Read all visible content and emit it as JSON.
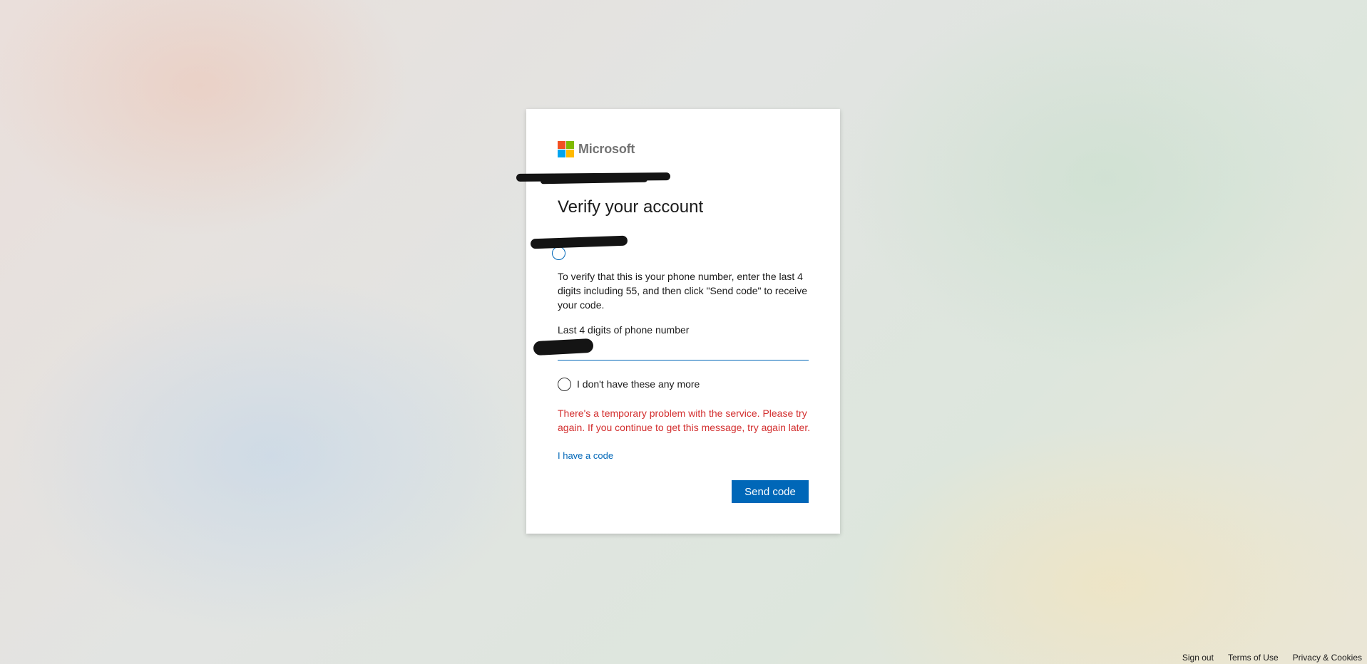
{
  "brand": {
    "name": "Microsoft",
    "logo_colors": [
      "#f25022",
      "#7fba00",
      "#00a4ef",
      "#ffb900"
    ]
  },
  "card": {
    "title": "Verify your account",
    "description": "To verify that this is your phone number, enter the last 4 digits including 55, and then click \"Send code\" to receive your code.",
    "phone_label": "Last 4 digits of phone number",
    "phone_value": "",
    "alt_option_label": "I don't have these any more",
    "error_message": "There's a temporary problem with the service. Please try again. If you continue to get this message, try again later.",
    "have_code_link": "I have a code",
    "send_button": "Send code"
  },
  "footer": {
    "links": [
      "Sign out",
      "Terms of Use",
      "Privacy & Cookies"
    ]
  },
  "colors": {
    "accent": "#0067b8",
    "error": "#d32f2f"
  }
}
